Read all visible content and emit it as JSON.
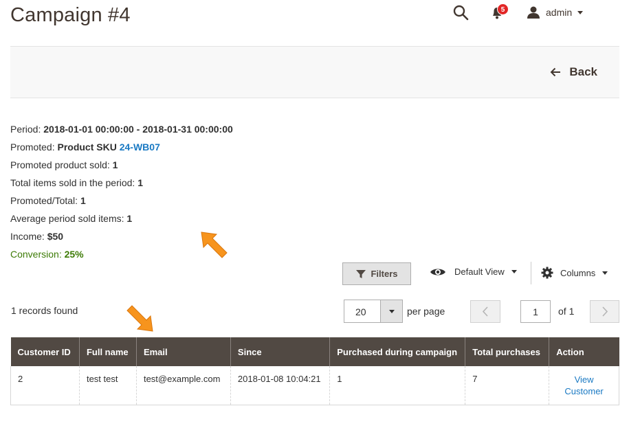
{
  "header": {
    "title": "Campaign #4",
    "notifications_count": "5",
    "user": "admin"
  },
  "action_bar": {
    "back_label": "Back"
  },
  "info": {
    "period_label": "Period: ",
    "period_value": "2018-01-01 00:00:00 - 2018-01-31 00:00:00",
    "promoted_label": "Promoted: ",
    "promoted_value": "Product SKU ",
    "promoted_sku": "24-WB07",
    "promoted_sold_label": "Promoted product sold: ",
    "promoted_sold_value": "1",
    "total_items_label": "Total items sold in the period: ",
    "total_items_value": "1",
    "ratio_label": "Promoted/Total: ",
    "ratio_value": "1",
    "avg_label": "Average period sold items: ",
    "avg_value": "1",
    "income_label": "Income: ",
    "income_value": "$50",
    "conversion_label": "Conversion: ",
    "conversion_value": "25%"
  },
  "toolbar": {
    "filters_label": "Filters",
    "view_label": "Default View",
    "columns_label": "Columns",
    "records_found": "1 records found",
    "per_page_value": "20",
    "per_page_label": "per page",
    "current_page": "1",
    "of_pages": "of 1"
  },
  "table": {
    "columns": [
      "Customer ID",
      "Full name",
      "Email",
      "Since",
      "Purchased during campaign",
      "Total purchases",
      "Action"
    ],
    "rows": [
      {
        "customer_id": "2",
        "full_name": "test test",
        "email": "test@example.com",
        "since": "2018-01-08 10:04:21",
        "purchased_during_campaign": "1",
        "total_purchases": "7",
        "action_line1": "View",
        "action_line2": "Customer"
      }
    ]
  },
  "colors": {
    "header_bg": "#514943",
    "link": "#1979c3",
    "conversion": "#3d7b06",
    "badge": "#e22626",
    "arrow": "#f7941d"
  }
}
